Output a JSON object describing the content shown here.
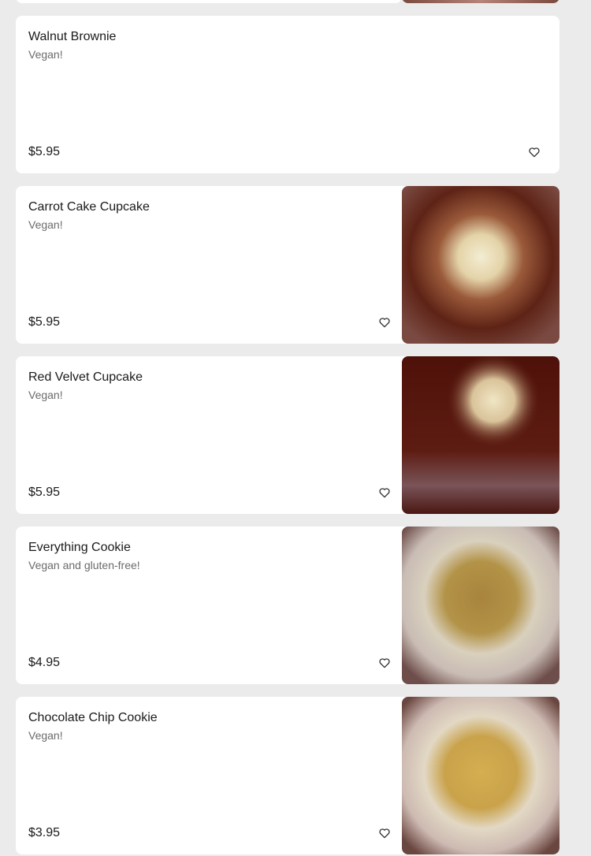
{
  "items": [
    {
      "name": "Walnut Brownie",
      "description": "Vegan!",
      "price": "$5.95",
      "has_image": false
    },
    {
      "name": "Carrot Cake Cupcake",
      "description": "Vegan!",
      "price": "$5.95",
      "has_image": true,
      "image_name": "carrot-cake-cupcake-image"
    },
    {
      "name": "Red Velvet Cupcake",
      "description": "Vegan!",
      "price": "$5.95",
      "has_image": true,
      "image_name": "red-velvet-cupcake-image"
    },
    {
      "name": "Everything Cookie",
      "description": "Vegan and gluten-free!",
      "price": "$4.95",
      "has_image": true,
      "image_name": "everything-cookie-image"
    },
    {
      "name": "Chocolate Chip Cookie",
      "description": "Vegan!",
      "price": "$3.95",
      "has_image": true,
      "image_name": "chocolate-chip-cookie-image"
    }
  ],
  "icons": {
    "favorite": "heart-outline-icon"
  },
  "colors": {
    "background": "#ebebeb",
    "card": "#ffffff",
    "text_primary": "#1a1a1a",
    "text_secondary": "#6b6b6b"
  }
}
